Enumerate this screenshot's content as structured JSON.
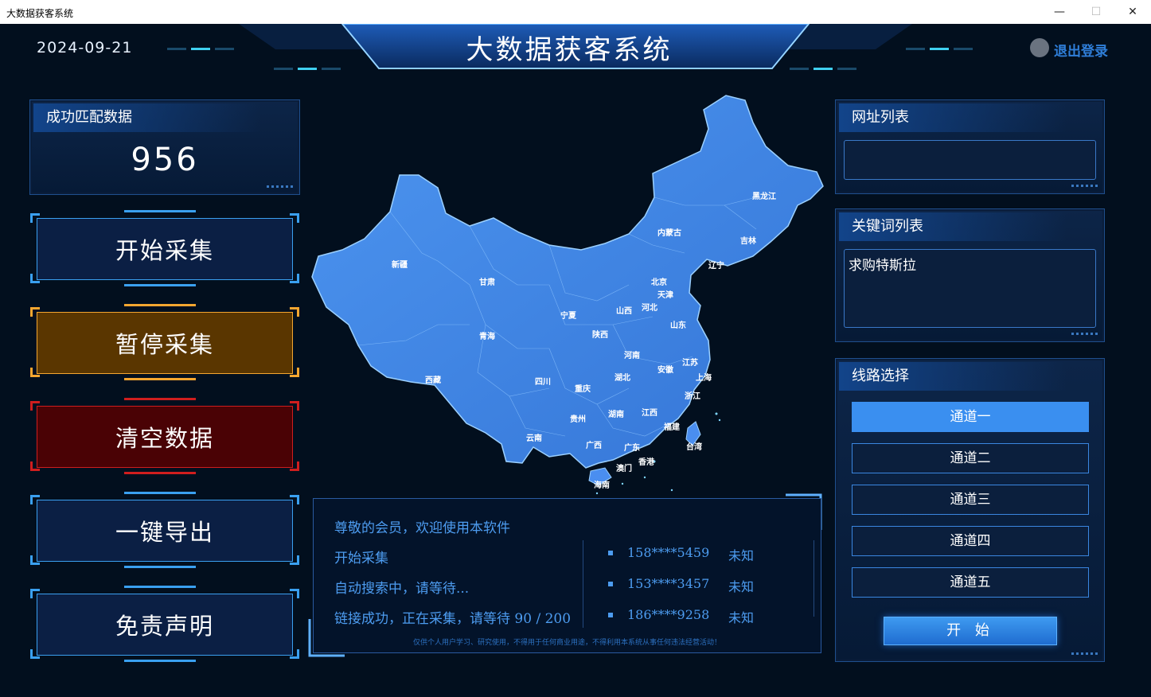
{
  "window": {
    "title": "大数据获客系统",
    "minimize": "—",
    "maximize": "☐",
    "close": "✕"
  },
  "header": {
    "date": "2024-09-21",
    "title": "大数据获客系统",
    "logout": "退出登录"
  },
  "stats": {
    "title": "成功匹配数据",
    "value": "956"
  },
  "commands": [
    {
      "label": "开始采集",
      "color": "#3aa0f0",
      "fill": "#0b1f44"
    },
    {
      "label": "暂停采集",
      "color": "#f5a630",
      "fill": "#5a3600"
    },
    {
      "label": "清空数据",
      "color": "#d01e1e",
      "fill": "#4a0205"
    },
    {
      "label": "一键导出",
      "color": "#3aa0f0",
      "fill": "#0b1f44"
    },
    {
      "label": "免责声明",
      "color": "#3aa0f0",
      "fill": "#0b1f44"
    }
  ],
  "map": {
    "fill": "#3f86e8",
    "provinces": [
      "黑龙江",
      "吉林",
      "辽宁",
      "内蒙古",
      "北京",
      "天津",
      "河北",
      "山西",
      "山东",
      "新疆",
      "甘肃",
      "宁夏",
      "陕西",
      "青海",
      "西藏",
      "四川",
      "重庆",
      "河南",
      "湖北",
      "安徽",
      "江苏",
      "上海",
      "浙江",
      "江西",
      "湖南",
      "贵州",
      "云南",
      "广西",
      "广东",
      "福建",
      "台湾",
      "澳门",
      "香港",
      "海南"
    ]
  },
  "log": {
    "lines": [
      "尊敬的会员，欢迎使用本软件",
      "开始采集",
      "自动搜索中，请等待...",
      "链接成功，正在采集，请等待 90 / 200"
    ],
    "phones": [
      {
        "number": "158****5459",
        "status": "未知"
      },
      {
        "number": "153****3457",
        "status": "未知"
      },
      {
        "number": "186****9258",
        "status": "未知"
      }
    ],
    "disclaimer": "仅供个人用户学习、研究使用，不得用于任何商业用途，不得利用本系统从事任何违法经营活动！"
  },
  "url_list": {
    "title": "网址列表",
    "value": ""
  },
  "keyword_list": {
    "title": "关键词列表",
    "value": "求购特斯拉"
  },
  "route": {
    "title": "线路选择",
    "channels": [
      "通道一",
      "通道二",
      "通道三",
      "通道四",
      "通道五"
    ],
    "selected_index": 0,
    "start": "开 始"
  }
}
